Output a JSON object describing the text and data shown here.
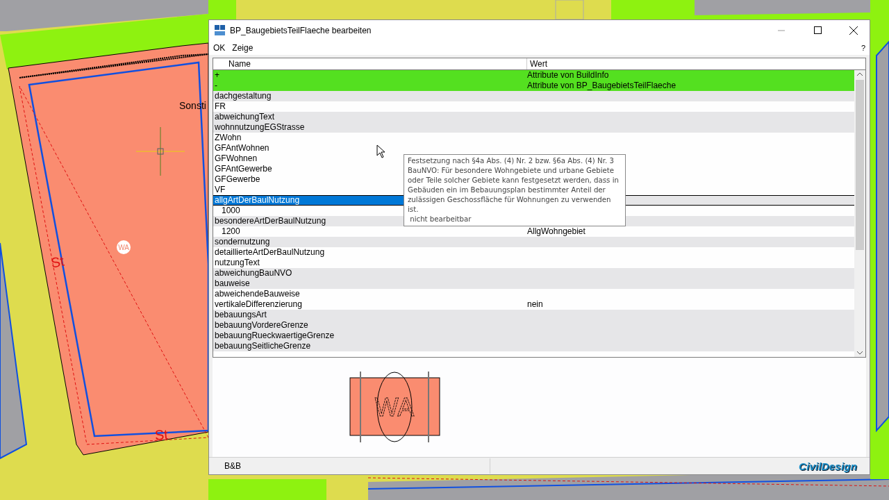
{
  "map": {
    "labels": [
      {
        "text": "Sonsti",
        "kind": "name"
      },
      {
        "text": "St",
        "kind": "street"
      },
      {
        "text": "St",
        "kind": "street"
      },
      {
        "text": "WA",
        "kind": "badge"
      }
    ]
  },
  "window": {
    "title": "BP_BaugebietsTeilFlaeche bearbeiten"
  },
  "menu": {
    "items": [
      "OK",
      "Zeige"
    ],
    "help": "?"
  },
  "table": {
    "columns": [
      "Name",
      "Wert"
    ],
    "rows": [
      {
        "name": "+",
        "value": "Attribute von BuildInfo",
        "kind": "group",
        "selected": false
      },
      {
        "name": "-",
        "value": "Attribute von BP_BaugebietsTeilFlaeche",
        "kind": "group",
        "selected": false
      },
      {
        "name": "dachgestaltung",
        "kind": "attribute",
        "shaded": true,
        "selected": false
      },
      {
        "name": "FR",
        "kind": "attribute",
        "shaded": false,
        "selected": false
      },
      {
        "name": "abweichungText",
        "kind": "attribute",
        "shaded": true,
        "selected": false
      },
      {
        "name": "wohnnutzungEGStrasse",
        "kind": "attribute",
        "shaded": true,
        "selected": false
      },
      {
        "name": "ZWohn",
        "kind": "attribute",
        "shaded": false,
        "selected": false
      },
      {
        "name": "GFAntWohnen",
        "kind": "attribute",
        "shaded": false,
        "selected": false
      },
      {
        "name": "GFWohnen",
        "kind": "attribute",
        "shaded": false,
        "selected": false
      },
      {
        "name": "GFAntGewerbe",
        "kind": "attribute",
        "shaded": false,
        "selected": false
      },
      {
        "name": "GFGewerbe",
        "kind": "attribute",
        "shaded": false,
        "selected": false
      },
      {
        "name": "VF",
        "kind": "attribute",
        "shaded": false,
        "selected": false
      },
      {
        "name": "allgArtDerBaulNutzung",
        "kind": "attribute",
        "shaded": true,
        "selected": true,
        "children": [
          {
            "name": "1000",
            "kind": "attribute",
            "shaded": false,
            "selected": false
          }
        ]
      },
      {
        "name": "besondereArtDerBaulNutzung",
        "kind": "attribute",
        "shaded": true,
        "selected": false,
        "children": [
          {
            "name": "1200",
            "value": "AllgWohngebiet",
            "kind": "attribute",
            "shaded": false,
            "selected": false
          }
        ]
      },
      {
        "name": "sondernutzung",
        "kind": "attribute",
        "shaded": true,
        "selected": false
      },
      {
        "name": "detaillierteArtDerBaulNutzung",
        "kind": "attribute",
        "shaded": false,
        "selected": false
      },
      {
        "name": "nutzungText",
        "kind": "attribute",
        "shaded": false,
        "selected": false
      },
      {
        "name": "abweichungBauNVO",
        "kind": "attribute",
        "shaded": true,
        "selected": false
      },
      {
        "name": "bauweise",
        "kind": "attribute",
        "shaded": true,
        "selected": false
      },
      {
        "name": "abweichendeBauweise",
        "kind": "attribute",
        "shaded": false,
        "selected": false
      },
      {
        "name": "vertikaleDifferenzierung",
        "value": "nein",
        "kind": "attribute",
        "shaded": false,
        "selected": false
      },
      {
        "name": "bebauungsArt",
        "kind": "attribute",
        "shaded": true,
        "selected": false
      },
      {
        "name": "bebauungVordereGrenze",
        "kind": "attribute",
        "shaded": true,
        "selected": false
      },
      {
        "name": "bebauungRueckwaertigeGrenze",
        "kind": "attribute",
        "shaded": true,
        "selected": false
      },
      {
        "name": "bebauungSeitlicheGrenze",
        "kind": "attribute",
        "shaded": true,
        "selected": false
      }
    ]
  },
  "tooltip": {
    "text": "Festsetzung nach §4a Abs. (4) Nr. 2 bzw. §6a Abs. (4) Nr. 3 BauNVO: Für besondere Wohngebiete und urbane Gebiete oder Teile solcher Gebiete kann festgesetzt werden, dass in Gebäuden ein im Bebauungsplan bestimmter Anteil der zulässigen Geschossfläche für Wohnungen zu verwenden ist.",
    "note": " nicht bearbeitbar"
  },
  "preview": {
    "label": "WA"
  },
  "status_bar": {
    "text": "B&B",
    "brand": "CivilDesign"
  }
}
